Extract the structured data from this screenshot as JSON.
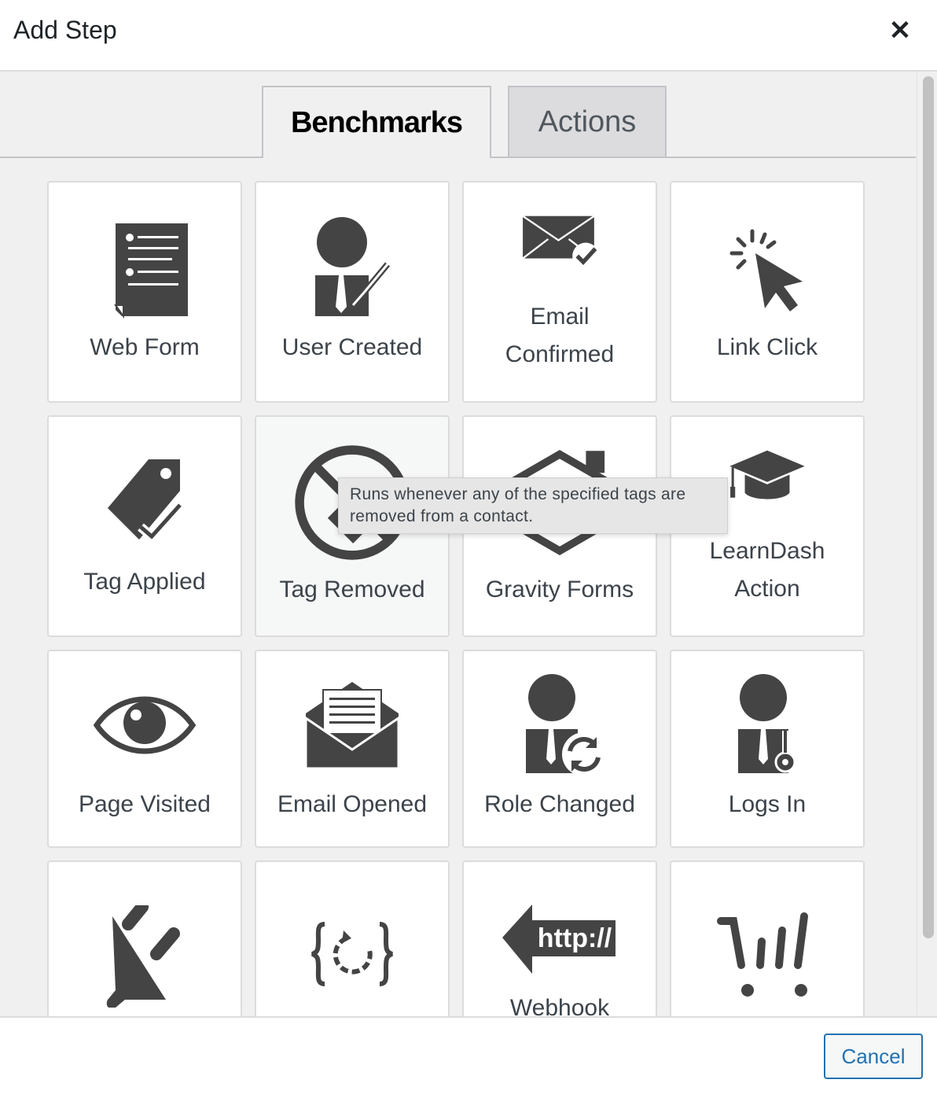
{
  "header": {
    "title": "Add Step",
    "close_icon": "close-icon"
  },
  "tabs": [
    {
      "label": "Benchmarks",
      "active": true
    },
    {
      "label": "Actions",
      "active": false
    }
  ],
  "cards": [
    {
      "label": "Web Form",
      "icon": "form-icon"
    },
    {
      "label": "User Created",
      "icon": "user-check-icon"
    },
    {
      "label": "Email Confirmed",
      "icon": "email-check-icon"
    },
    {
      "label": "Link Click",
      "icon": "cursor-click-icon"
    },
    {
      "label": "Tag Applied",
      "icon": "tag-check-icon"
    },
    {
      "label": "Tag Removed",
      "icon": "tag-removed-icon",
      "hovered": true
    },
    {
      "label": "Gravity Forms",
      "icon": "gravity-forms-icon"
    },
    {
      "label": "LearnDash Action",
      "icon": "graduation-cap-icon"
    },
    {
      "label": "Page Visited",
      "icon": "eye-icon"
    },
    {
      "label": "Email Opened",
      "icon": "envelope-open-icon"
    },
    {
      "label": "Role Changed",
      "icon": "user-refresh-icon"
    },
    {
      "label": "Logs In",
      "icon": "user-key-icon"
    },
    {
      "label": "",
      "icon": "plug-icon"
    },
    {
      "label": "",
      "icon": "code-refresh-icon"
    },
    {
      "label": "Webhook",
      "icon": "webhook-icon"
    },
    {
      "label": "",
      "icon": "cart-icon"
    }
  ],
  "tooltip": "Runs whenever any of the specified tags are removed from a contact.",
  "footer": {
    "cancel_label": "Cancel"
  },
  "colors": {
    "icon": "#444444",
    "accent": "#2271b1",
    "panel_bg": "#f0f0f1"
  }
}
